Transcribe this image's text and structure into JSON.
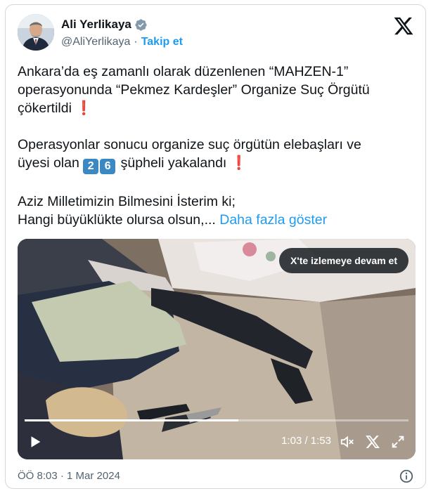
{
  "user": {
    "name": "Ali Yerlikaya",
    "handle": "@AliYerlikaya",
    "separator": "·",
    "follow_label": "Takip et"
  },
  "tweet": {
    "p1_text": "Ankara’da eş zamanlı olarak düzenlenen “MAHZEN-1” operasyonunda “Pekmez Kardeşler” Organize Suç Örgütü çökertildi",
    "p1_line1": "Ankara’da eş zamanlı olarak düzenlenen “MAHZEN-1”",
    "p1_line2": "operasyonunda “Pekmez Kardeşler” Organize Suç Örgütü",
    "p1_line3": "çökertildi",
    "p2_line1": "Operasyonlar sonucu organize suç örgütün elebaşları ve",
    "p2_line2_pre": "üyesi olan",
    "count_digit1": "2",
    "count_digit2": "6",
    "p2_line2_post": "şüpheli yakalandı",
    "p3_line1": "Aziz Milletimizin Bilmesini İsterim ki;",
    "p3_line2": "Hangi büyüklükte olursa olsun,...",
    "show_more": "Daha fazla göster",
    "exclamation": "❗"
  },
  "video": {
    "continue_label": "X'te izlemeye devam et",
    "time_display": "1:03 / 1:53",
    "progress": 0.557
  },
  "footer": {
    "timestamp": "ÖÖ 8:03 · 1 Mar 2024"
  },
  "colors": {
    "accent": "#1d9bf0",
    "text": "#0f1419",
    "muted": "#536471",
    "verified": "#829aab"
  },
  "icons": [
    "verified-badge-icon",
    "x-logo-icon",
    "play-icon",
    "mute-icon",
    "x-watermark-icon",
    "fullscreen-icon",
    "info-icon"
  ]
}
